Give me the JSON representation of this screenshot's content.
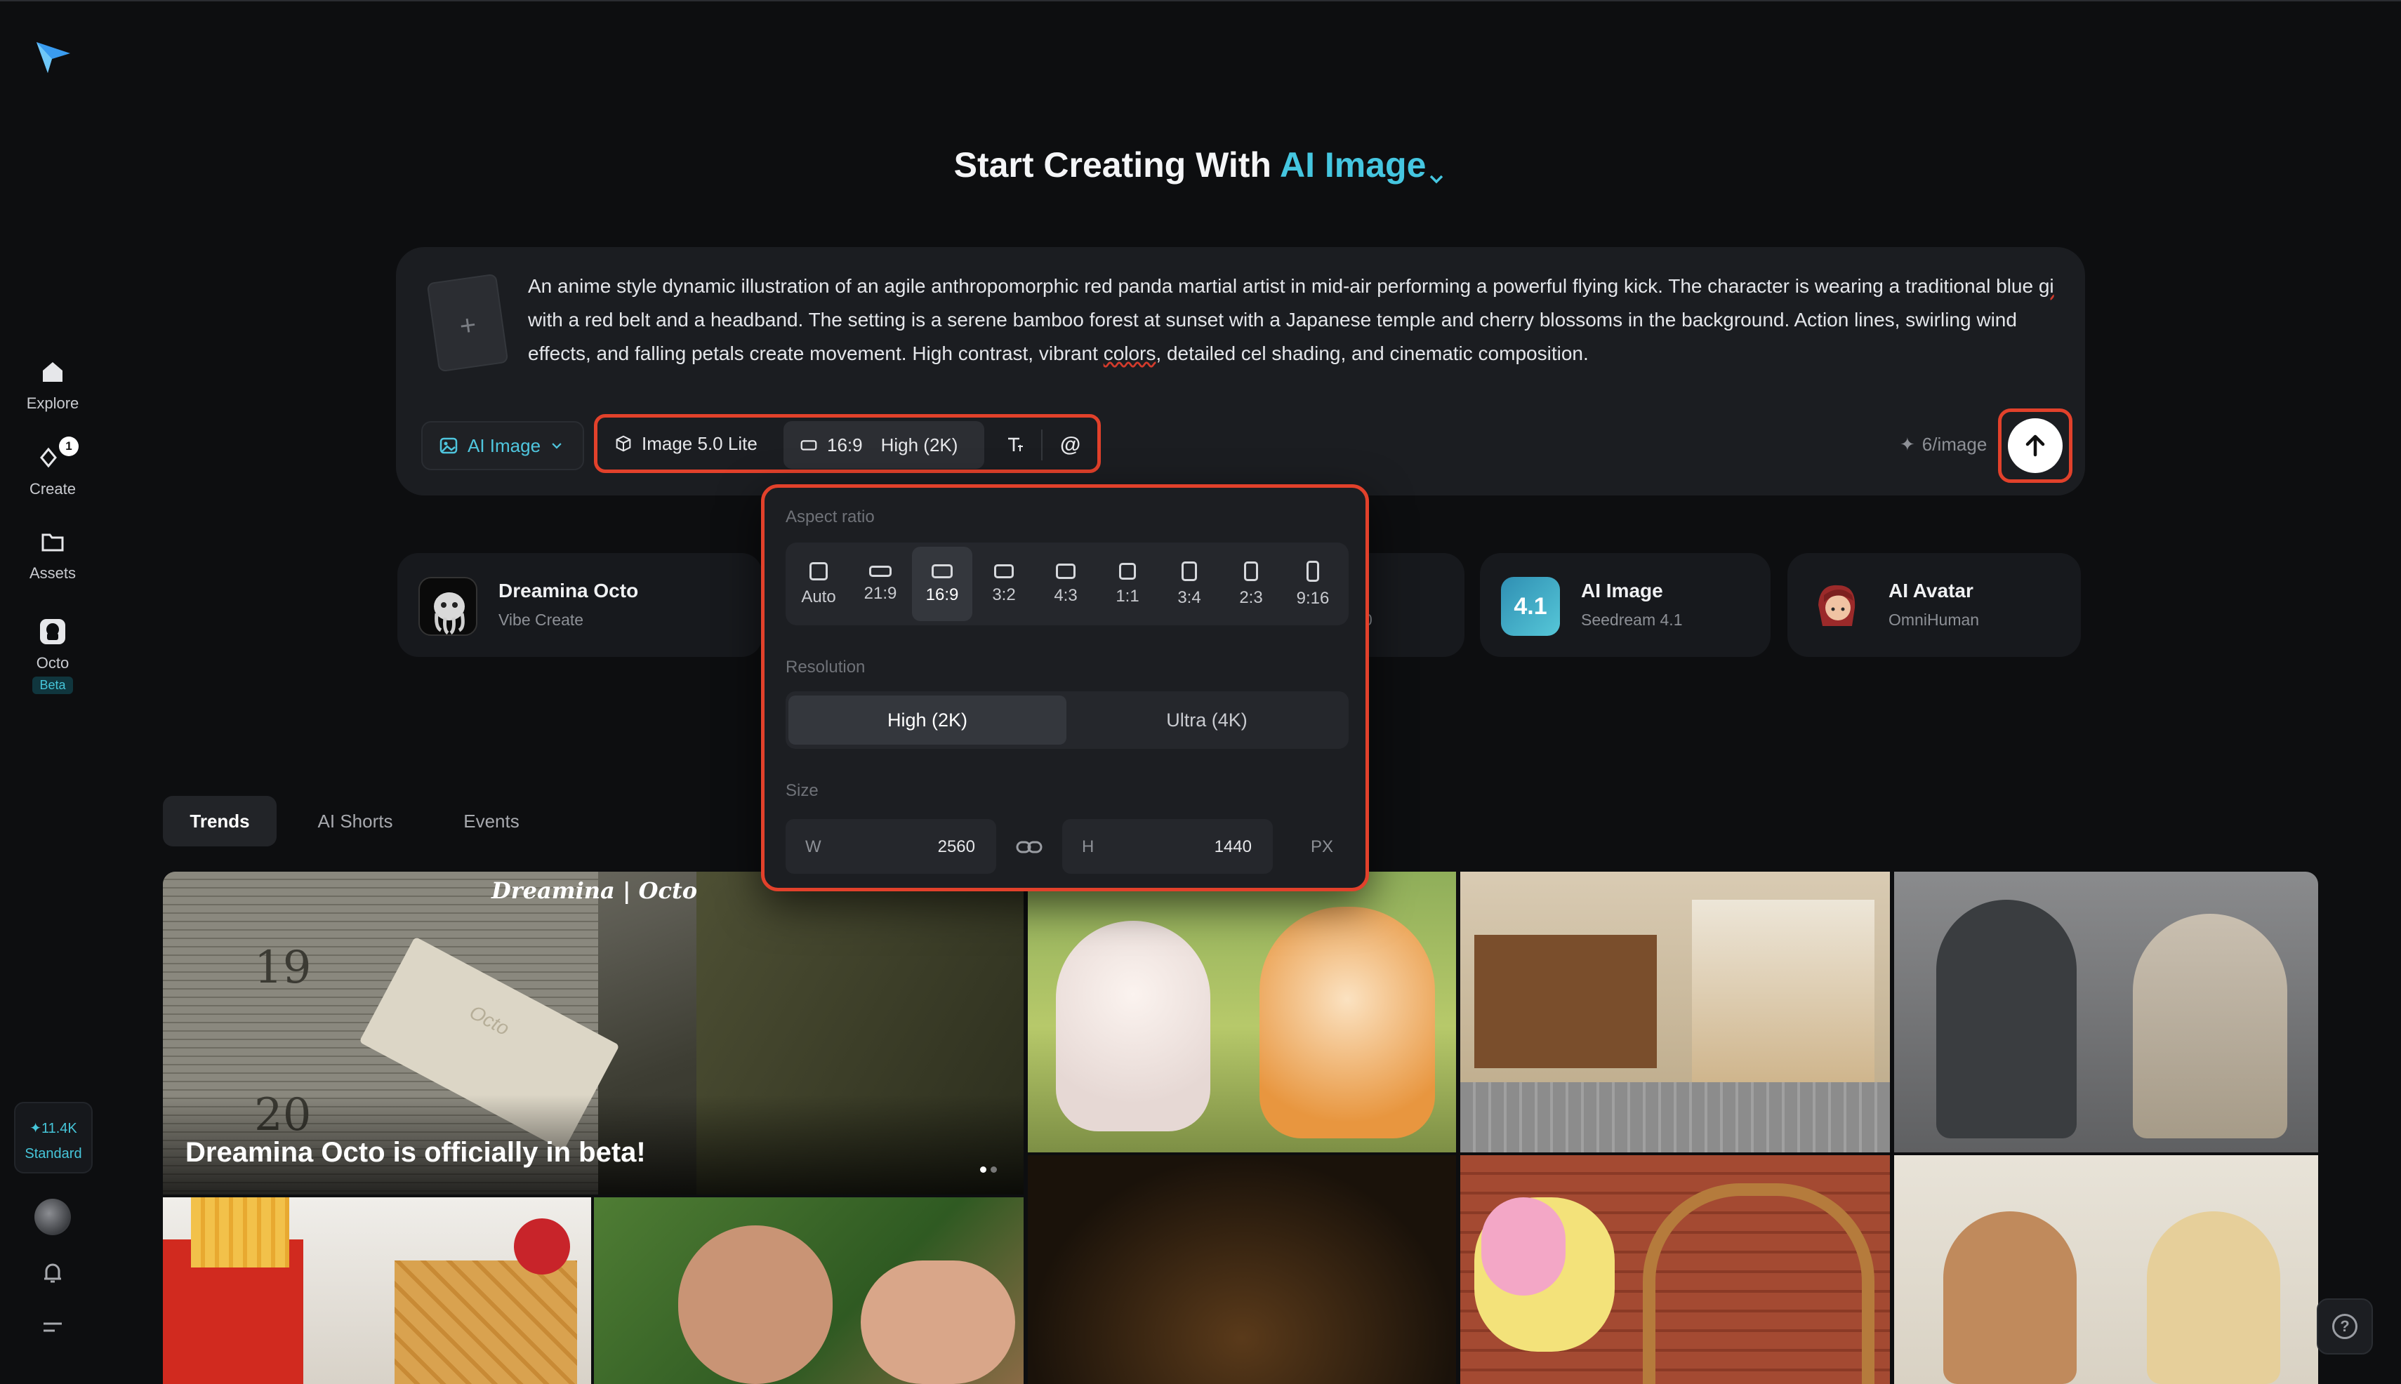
{
  "sidebar": {
    "items": [
      {
        "label": "Explore",
        "icon": "home-icon"
      },
      {
        "label": "Create",
        "icon": "create-sparkle-icon",
        "badge": "1"
      },
      {
        "label": "Assets",
        "icon": "folder-icon"
      },
      {
        "label": "Octo",
        "icon": "octo-icon",
        "tag": "Beta"
      }
    ],
    "credits": {
      "amount": "11.4K",
      "plan": "Standard"
    }
  },
  "header": {
    "prefix": "Start Creating With",
    "mode": "AI Image"
  },
  "prompt": {
    "text_before": "An anime style dynamic illustration of an agile anthropomorphic red panda martial artist in mid-air performing a powerful flying kick. The character is wearing a traditional blue ",
    "spell1": "gi",
    "text_mid1": " with a red belt and a headband. The setting is a serene bamboo forest at sunset with a Japanese temple and cherry blossoms in the background. Action lines, swirling wind effects, and falling petals create movement. High contrast, vibrant ",
    "spell2": "colors",
    "text_after": ", detailed cel shading, and cinematic composition.",
    "upload_symbol": "+"
  },
  "toolbar": {
    "mode_label": "AI Image",
    "model_label": "Image 5.0 Lite",
    "ratio_label": "16:9",
    "quality_label": "High (2K)",
    "mention_symbol": "@",
    "cost": "6/image"
  },
  "popover": {
    "aspect_title": "Aspect ratio",
    "ratios": [
      "Auto",
      "21:9",
      "16:9",
      "3:2",
      "4:3",
      "1:1",
      "3:4",
      "2:3",
      "9:16"
    ],
    "selected_ratio": "16:9",
    "resolution_title": "Resolution",
    "resolutions": [
      "High (2K)",
      "Ultra (4K)"
    ],
    "selected_resolution": "High (2K)",
    "size_title": "Size",
    "width_label": "W",
    "width_value": "2560",
    "height_label": "H",
    "height_value": "1440",
    "unit": "PX"
  },
  "features": [
    {
      "title": "Dreamina Octo",
      "subtitle": "Vibe Create"
    },
    {
      "title": "AI Image",
      "subtitle": "Seedream 4.1",
      "icon_text": "4.1"
    },
    {
      "title": "AI Avatar",
      "subtitle": "OmniHuman"
    }
  ],
  "feature_partial": "0",
  "tabs": [
    "Trends",
    "AI Shorts",
    "Events"
  ],
  "hero": {
    "title": "Dreamina Octo is officially in beta!",
    "brand": "Dreamina | Octo",
    "mailbox1": "19",
    "mailbox2": "20",
    "envelope_text": "Octo"
  },
  "help_symbol": "?",
  "colors": {
    "accent": "#45c6e0",
    "highlight": "#e2412b",
    "background": "#0d0e10"
  }
}
